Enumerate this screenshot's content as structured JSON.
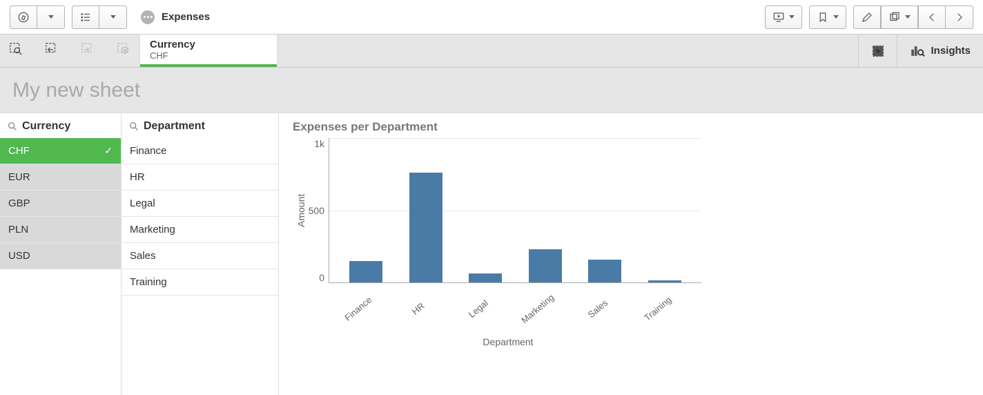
{
  "toolbar": {
    "app_name": "Expenses",
    "insights_label": "Insights"
  },
  "selection": {
    "field": "Currency",
    "value": "CHF"
  },
  "sheet": {
    "title": "My new sheet"
  },
  "filters": {
    "currency": {
      "label": "Currency",
      "items": [
        {
          "label": "CHF",
          "state": "selected"
        },
        {
          "label": "EUR",
          "state": "excluded"
        },
        {
          "label": "GBP",
          "state": "excluded"
        },
        {
          "label": "PLN",
          "state": "excluded"
        },
        {
          "label": "USD",
          "state": "excluded"
        }
      ]
    },
    "department": {
      "label": "Department",
      "items": [
        {
          "label": "Finance",
          "state": "possible"
        },
        {
          "label": "HR",
          "state": "possible"
        },
        {
          "label": "Legal",
          "state": "possible"
        },
        {
          "label": "Marketing",
          "state": "possible"
        },
        {
          "label": "Sales",
          "state": "possible"
        },
        {
          "label": "Training",
          "state": "possible"
        }
      ]
    }
  },
  "chart_data": {
    "type": "bar",
    "title": "Expenses per Department",
    "xlabel": "Department",
    "ylabel": "Amount",
    "ylim": [
      0,
      1000
    ],
    "y_ticks": [
      "1k",
      "500",
      "0"
    ],
    "categories": [
      "Finance",
      "HR",
      "Legal",
      "Marketing",
      "Sales",
      "Training"
    ],
    "values": [
      150,
      760,
      60,
      230,
      160,
      15
    ]
  }
}
